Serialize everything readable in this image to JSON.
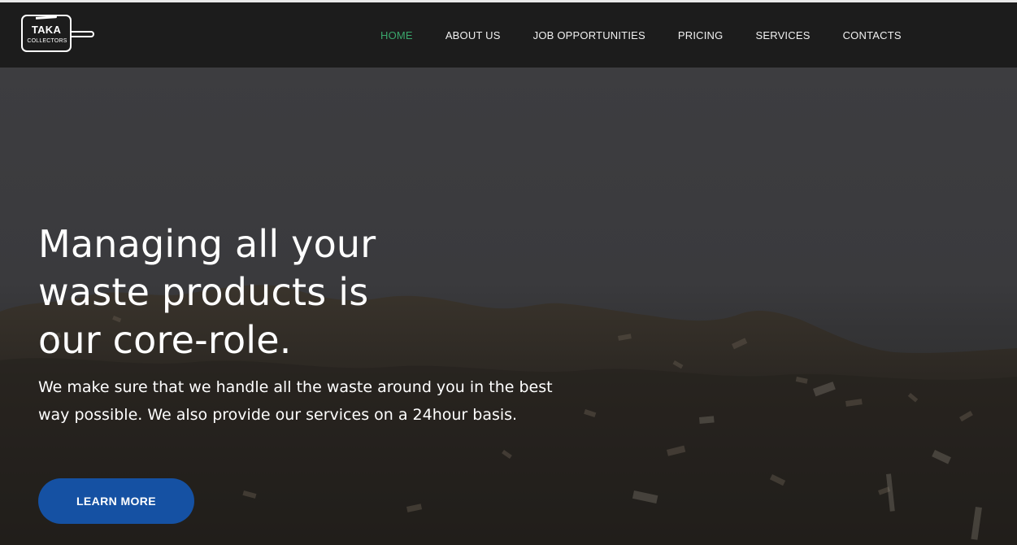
{
  "brand": {
    "logo_title": "TAKA",
    "logo_subtitle": "COLLECTORS"
  },
  "nav": {
    "items": [
      {
        "label": "HOME",
        "active": true
      },
      {
        "label": "ABOUT US",
        "active": false
      },
      {
        "label": "JOB OPPORTUNITIES",
        "active": false
      },
      {
        "label": "PRICING",
        "active": false
      },
      {
        "label": "SERVICES",
        "active": false
      },
      {
        "label": "CONTACTS",
        "active": false
      }
    ]
  },
  "hero": {
    "headline": "Managing all your waste products is our core-role.",
    "subtext": "We make sure that we handle all the waste around you in the best way possible. We also provide our services on a 24hour basis.",
    "cta_label": "LEARN MORE"
  },
  "colors": {
    "navbar_bg": "#1c1c1c",
    "active_nav": "#3aa66c",
    "cta_bg": "#1551a3",
    "text": "#ffffff"
  }
}
